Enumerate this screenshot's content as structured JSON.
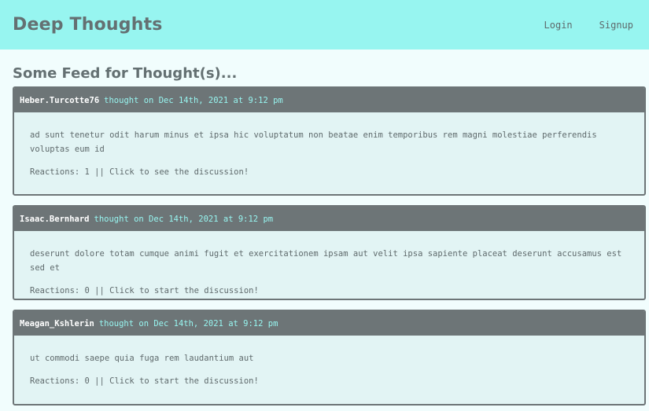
{
  "header": {
    "brand": "Deep Thoughts",
    "nav": {
      "login": "Login",
      "signup": "Signup"
    }
  },
  "feed": {
    "title": "Some Feed for Thought(s)...",
    "thoughts": [
      {
        "username": "Heber.Turcotte76",
        "meta": "thought on Dec 14th, 2021 at 9:12 pm",
        "text": "ad sunt tenetur odit harum minus et ipsa hic voluptatum non beatae enim temporibus rem magni molestiae perferendis voluptas eum id",
        "reactions": "Reactions: 1 || Click to see the discussion!"
      },
      {
        "username": "Isaac.Bernhard",
        "meta": "thought on Dec 14th, 2021 at 9:12 pm",
        "text": "deserunt dolore totam cumque animi fugit et exercitationem ipsam aut velit ipsa sapiente placeat deserunt accusamus est sed et",
        "reactions": "Reactions: 0 || Click to start the discussion!"
      },
      {
        "username": "Meagan_Kshlerin",
        "meta": "thought on Dec 14th, 2021 at 9:12 pm",
        "text": "ut commodi saepe quia fuga rem laudantium aut",
        "reactions": "Reactions: 0 || Click to start the discussion!"
      }
    ]
  },
  "colors": {
    "header_bg": "#97f5f0",
    "page_bg": "#f1fdfd",
    "card_head_bg": "#6d7577",
    "card_body_bg": "#e2f4f4",
    "meta_text": "#97f5f0"
  }
}
